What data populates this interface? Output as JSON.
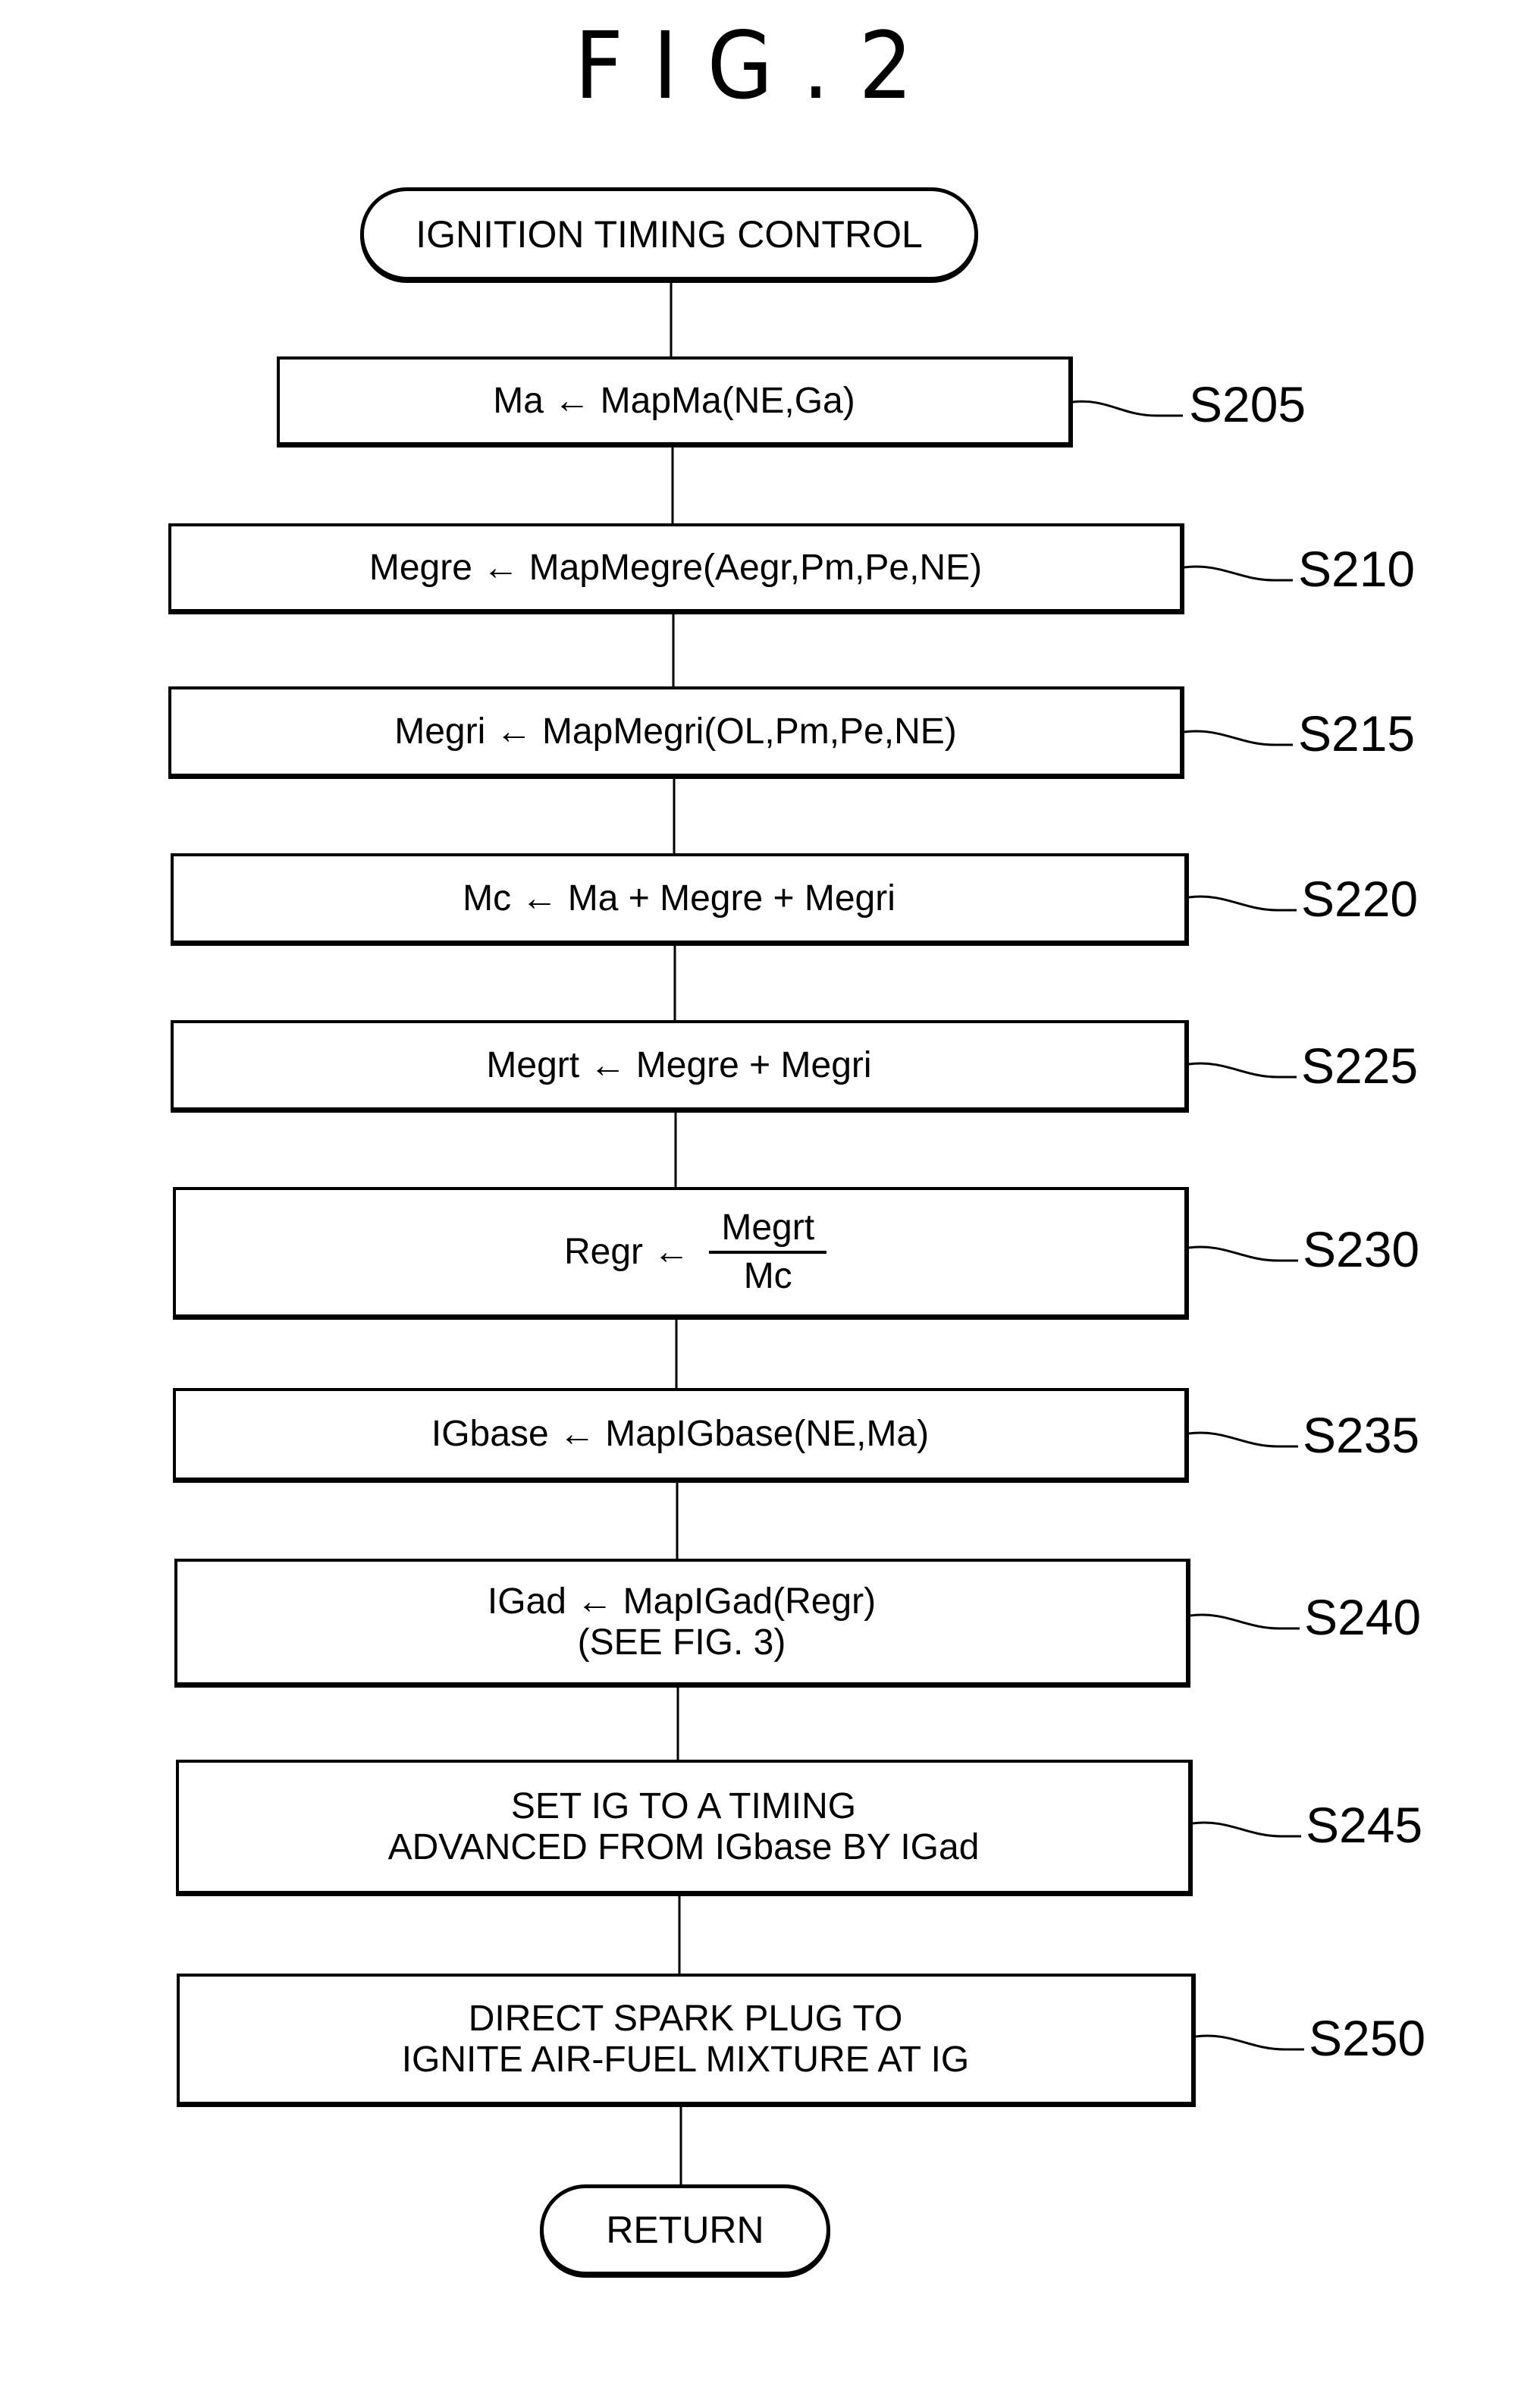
{
  "figure": {
    "title": "FIG.2"
  },
  "flowchart": {
    "start": "IGNITION TIMING CONTROL",
    "end": "RETURN",
    "steps": [
      {
        "id": "S205",
        "lines": [
          "Ma ← MapMa(NE,Ga)"
        ]
      },
      {
        "id": "S210",
        "lines": [
          "Megre ← MapMegre(Aegr,Pm,Pe,NE)"
        ]
      },
      {
        "id": "S215",
        "lines": [
          "Megri ← MapMegri(OL,Pm,Pe,NE)"
        ]
      },
      {
        "id": "S220",
        "lines": [
          "Mc ← Ma + Megre + Megri"
        ]
      },
      {
        "id": "S225",
        "lines": [
          "Megrt ← Megre + Megri"
        ]
      },
      {
        "id": "S230",
        "lhs": "Regr ←",
        "numerator": "Megrt",
        "denominator": "Mc"
      },
      {
        "id": "S235",
        "lines": [
          "IGbase ← MapIGbase(NE,Ma)"
        ]
      },
      {
        "id": "S240",
        "lines": [
          "IGad ← MapIGad(Regr)",
          "(SEE FIG. 3)"
        ]
      },
      {
        "id": "S245",
        "lines": [
          "SET IG TO A TIMING",
          "ADVANCED FROM IGbase BY IGad"
        ]
      },
      {
        "id": "S250",
        "lines": [
          "DIRECT SPARK PLUG TO",
          "IGNITE AIR-FUEL MIXTURE AT IG"
        ]
      }
    ]
  }
}
